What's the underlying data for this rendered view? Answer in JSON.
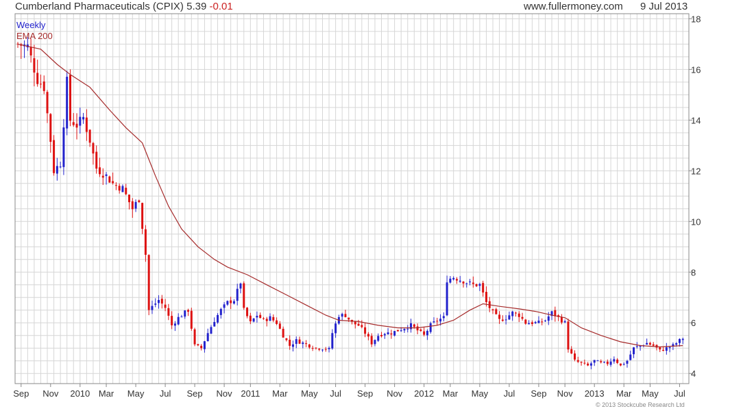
{
  "header": {
    "title": "Cumberland Pharmaceuticals (CPIX)",
    "price": "5.39",
    "change": "-0.01",
    "website": "www.fullermoney.com",
    "date": "9 Jul 2013"
  },
  "legend": {
    "weekly": "Weekly",
    "ema": "EMA 200"
  },
  "copyright": "© 2013 Stockcube Research Ltd",
  "colors": {
    "up": "#2222cc",
    "down": "#dd1111",
    "ema": "#a52a2a",
    "grid": "#d6d6d6",
    "frame": "#888888"
  },
  "chart_data": {
    "type": "candlestick",
    "title": "Cumberland Pharmaceuticals (CPIX)",
    "interval": "Weekly",
    "ylim": [
      3.6,
      18.2
    ],
    "y_ticks": [
      4,
      6,
      8,
      10,
      12,
      14,
      16,
      18
    ],
    "grid": true,
    "y_axis_side": "right",
    "x_ticks": [
      {
        "label": "Sep",
        "week": 1
      },
      {
        "label": "Nov",
        "week": 10
      },
      {
        "label": "2010",
        "week": 19
      },
      {
        "label": "Mar",
        "week": 27
      },
      {
        "label": "May",
        "week": 36
      },
      {
        "label": "Jul",
        "week": 45
      },
      {
        "label": "Sep",
        "week": 54
      },
      {
        "label": "Nov",
        "week": 63
      },
      {
        "label": "2011",
        "week": 71
      },
      {
        "label": "Mar",
        "week": 80
      },
      {
        "label": "May",
        "week": 89
      },
      {
        "label": "Jul",
        "week": 97
      },
      {
        "label": "Sep",
        "week": 106
      },
      {
        "label": "Nov",
        "week": 115
      },
      {
        "label": "2012",
        "week": 124
      },
      {
        "label": "Mar",
        "week": 132
      },
      {
        "label": "May",
        "week": 141
      },
      {
        "label": "Jul",
        "week": 150
      },
      {
        "label": "Sep",
        "week": 159
      },
      {
        "label": "Nov",
        "week": 167
      },
      {
        "label": "2013",
        "week": 176
      },
      {
        "label": "Mar",
        "week": 185
      },
      {
        "label": "May",
        "week": 193
      },
      {
        "label": "Jul",
        "week": 202
      }
    ],
    "close_points": [
      [
        0,
        17.0
      ],
      [
        3,
        16.9
      ],
      [
        6,
        15.6
      ],
      [
        8,
        15.3
      ],
      [
        10,
        13.2
      ],
      [
        11,
        12.0
      ],
      [
        13,
        12.3
      ],
      [
        15,
        15.5
      ],
      [
        16,
        14.0
      ],
      [
        18,
        13.8
      ],
      [
        20,
        14.1
      ],
      [
        22,
        13.2
      ],
      [
        24,
        12.1
      ],
      [
        27,
        11.8
      ],
      [
        29,
        11.5
      ],
      [
        32,
        11.3
      ],
      [
        35,
        10.5
      ],
      [
        37,
        10.9
      ],
      [
        39,
        8.7
      ],
      [
        40,
        6.5
      ],
      [
        43,
        6.9
      ],
      [
        45,
        6.6
      ],
      [
        47,
        5.9
      ],
      [
        49,
        6.2
      ],
      [
        52,
        6.5
      ],
      [
        54,
        5.1
      ],
      [
        56,
        5.0
      ],
      [
        58,
        5.6
      ],
      [
        60,
        6.1
      ],
      [
        62,
        6.5
      ],
      [
        64,
        6.8
      ],
      [
        66,
        6.9
      ],
      [
        68,
        7.6
      ],
      [
        69,
        6.5
      ],
      [
        71,
        6.0
      ],
      [
        73,
        6.3
      ],
      [
        75,
        6.1
      ],
      [
        77,
        6.2
      ],
      [
        79,
        6.0
      ],
      [
        81,
        5.5
      ],
      [
        83,
        5.1
      ],
      [
        85,
        5.3
      ],
      [
        87,
        5.2
      ],
      [
        89,
        5.1
      ],
      [
        91,
        5.0
      ],
      [
        93,
        5.0
      ],
      [
        95,
        4.95
      ],
      [
        96,
        5.6
      ],
      [
        98,
        6.3
      ],
      [
        100,
        6.3
      ],
      [
        102,
        6.0
      ],
      [
        104,
        5.9
      ],
      [
        106,
        5.6
      ],
      [
        108,
        5.2
      ],
      [
        110,
        5.5
      ],
      [
        112,
        5.6
      ],
      [
        114,
        5.6
      ],
      [
        116,
        5.7
      ],
      [
        118,
        5.8
      ],
      [
        120,
        5.9
      ],
      [
        122,
        5.7
      ],
      [
        124,
        5.5
      ],
      [
        126,
        5.9
      ],
      [
        128,
        6.1
      ],
      [
        130,
        6.2
      ],
      [
        131,
        7.7
      ],
      [
        133,
        7.8
      ],
      [
        135,
        7.7
      ],
      [
        137,
        7.6
      ],
      [
        139,
        7.5
      ],
      [
        141,
        7.5
      ],
      [
        143,
        6.8
      ],
      [
        145,
        6.4
      ],
      [
        147,
        6.1
      ],
      [
        149,
        6.2
      ],
      [
        151,
        6.4
      ],
      [
        153,
        6.3
      ],
      [
        155,
        6.0
      ],
      [
        157,
        6.0
      ],
      [
        159,
        6.0
      ],
      [
        161,
        6.1
      ],
      [
        163,
        6.4
      ],
      [
        165,
        6.2
      ],
      [
        167,
        6.0
      ],
      [
        168,
        5.0
      ],
      [
        170,
        4.5
      ],
      [
        172,
        4.4
      ],
      [
        174,
        4.3
      ],
      [
        176,
        4.5
      ],
      [
        178,
        4.4
      ],
      [
        180,
        4.4
      ],
      [
        182,
        4.6
      ],
      [
        184,
        4.3
      ],
      [
        186,
        4.5
      ],
      [
        188,
        5.0
      ],
      [
        190,
        5.1
      ],
      [
        192,
        5.2
      ],
      [
        194,
        5.1
      ],
      [
        196,
        4.9
      ],
      [
        198,
        5.0
      ],
      [
        200,
        5.1
      ],
      [
        202,
        5.3
      ],
      [
        203,
        5.39
      ]
    ],
    "ema_points": [
      [
        0,
        17.0
      ],
      [
        7,
        16.8
      ],
      [
        12,
        16.2
      ],
      [
        16,
        15.8
      ],
      [
        22,
        15.3
      ],
      [
        28,
        14.4
      ],
      [
        33,
        13.7
      ],
      [
        38,
        13.1
      ],
      [
        42,
        11.8
      ],
      [
        46,
        10.6
      ],
      [
        50,
        9.7
      ],
      [
        55,
        9.0
      ],
      [
        60,
        8.5
      ],
      [
        64,
        8.2
      ],
      [
        70,
        7.9
      ],
      [
        76,
        7.5
      ],
      [
        82,
        7.1
      ],
      [
        88,
        6.7
      ],
      [
        94,
        6.3
      ],
      [
        98,
        6.1
      ],
      [
        104,
        6.05
      ],
      [
        110,
        5.9
      ],
      [
        116,
        5.8
      ],
      [
        122,
        5.8
      ],
      [
        128,
        5.9
      ],
      [
        133,
        6.1
      ],
      [
        138,
        6.5
      ],
      [
        142,
        6.75
      ],
      [
        147,
        6.65
      ],
      [
        153,
        6.55
      ],
      [
        158,
        6.45
      ],
      [
        163,
        6.3
      ],
      [
        167,
        6.2
      ],
      [
        172,
        5.8
      ],
      [
        178,
        5.5
      ],
      [
        184,
        5.25
      ],
      [
        190,
        5.1
      ],
      [
        196,
        5.05
      ],
      [
        203,
        5.1
      ]
    ]
  }
}
